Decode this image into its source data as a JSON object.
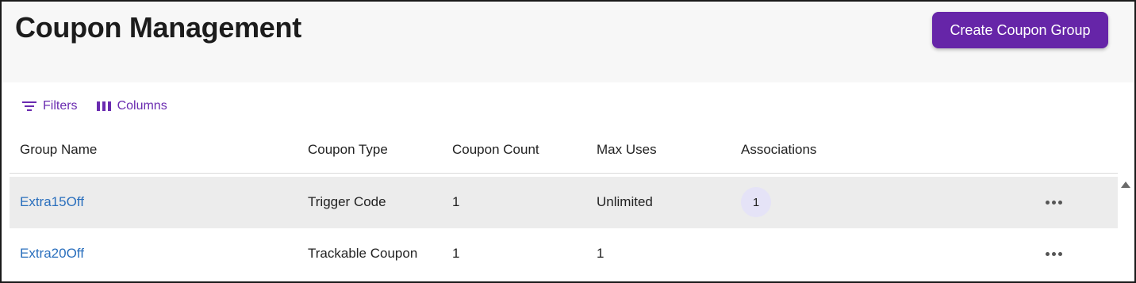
{
  "header": {
    "title": "Coupon Management",
    "create_label": "Create Coupon Group"
  },
  "toolbar": {
    "filters_label": "Filters",
    "filters_icon": "filter-icon",
    "columns_label": "Columns",
    "columns_icon": "columns-icon"
  },
  "table": {
    "columns": [
      "Group Name",
      "Coupon Type",
      "Coupon Count",
      "Max Uses",
      "Associations"
    ],
    "rows": [
      {
        "group_name": "Extra15Off",
        "coupon_type": "Trigger Code",
        "coupon_count": "1",
        "max_uses": "Unlimited",
        "associations": "1"
      },
      {
        "group_name": "Extra20Off",
        "coupon_type": "Trackable Coupon",
        "coupon_count": "1",
        "max_uses": "1",
        "associations": ""
      }
    ]
  },
  "colors": {
    "accent": "#6625a8",
    "link": "#2a6fbd",
    "row_highlight": "#ececec",
    "badge_bg": "#e5e3f7"
  }
}
